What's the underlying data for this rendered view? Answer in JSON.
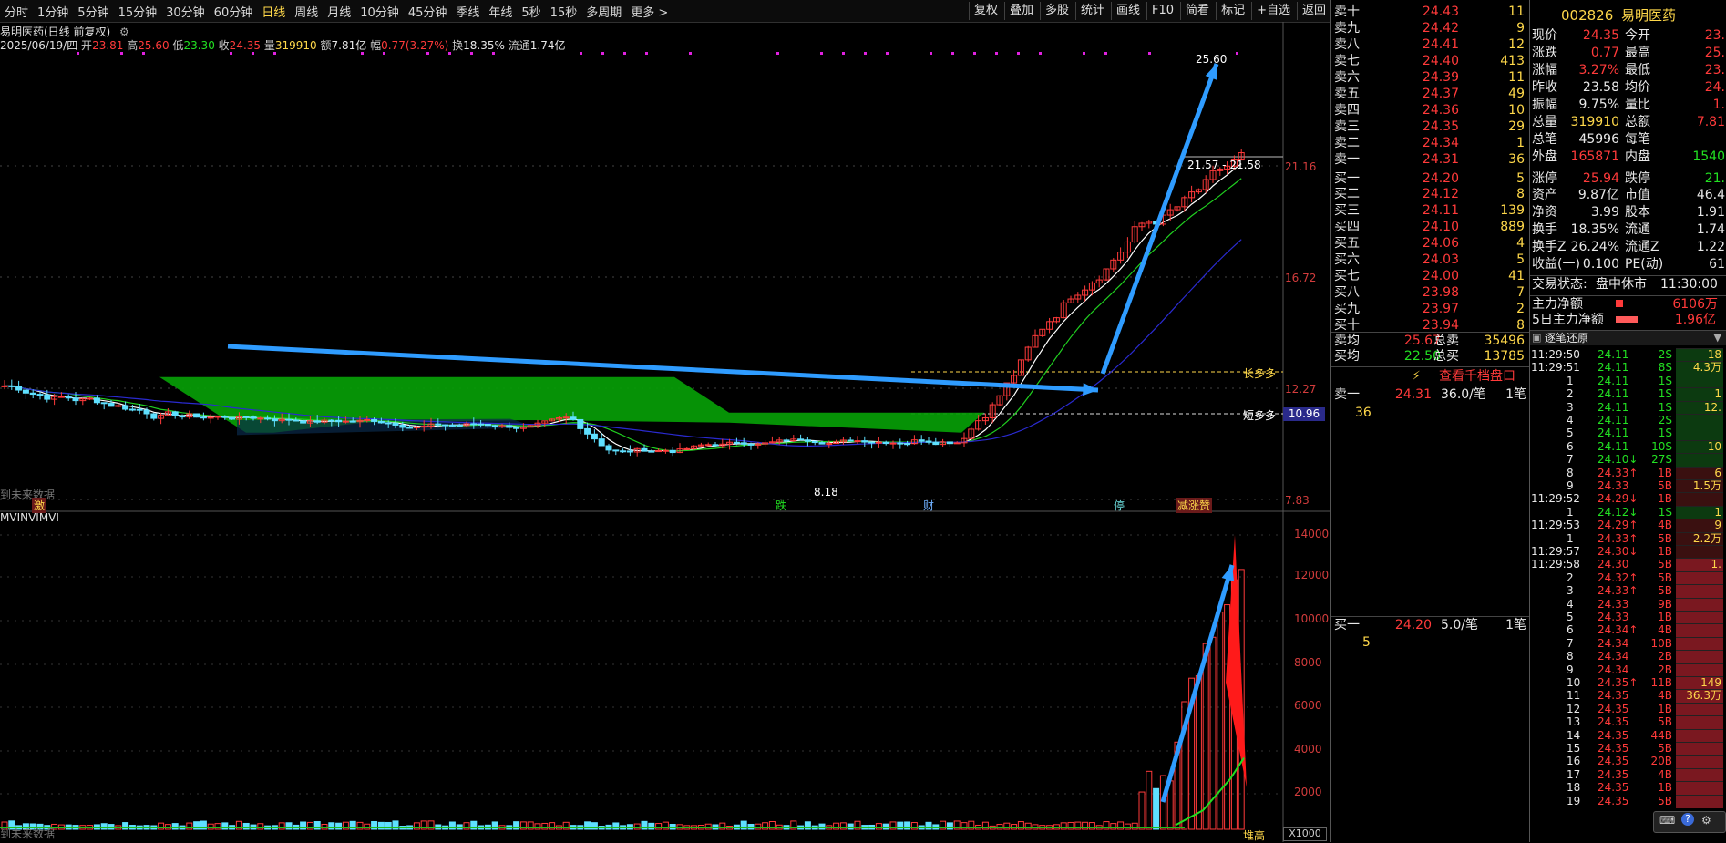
{
  "toolbar": {
    "periods": [
      "分时",
      "1分钟",
      "5分钟",
      "15分钟",
      "30分钟",
      "60分钟",
      "日线",
      "周线",
      "月线",
      "10分钟",
      "45分钟",
      "季线",
      "年线",
      "5秒",
      "15秒",
      "多周期",
      "更多 >"
    ],
    "active_period": "日线",
    "right_buttons": [
      "复权",
      "叠加",
      "多股",
      "统计",
      "画线",
      "F10",
      "简看",
      "标记",
      "+自选",
      "返回"
    ]
  },
  "chart": {
    "title": "易明医药(日线 前复权)",
    "date": "2025/06/19/四",
    "open_label": "开",
    "open": "23.81",
    "high_label": "高",
    "high": "25.60",
    "low_label": "低",
    "low": "23.30",
    "close_label": "收",
    "close": "24.35",
    "vol_label": "量",
    "vol": "319910",
    "amount_label": "额",
    "amount": "7.81亿",
    "change_label": "幅",
    "change": "0.77(3.27%)",
    "turnover_label": "换",
    "turnover": "18.35%",
    "float_label": "流通",
    "float_value": "1.74亿",
    "y_ticks": [
      "21.16",
      "16.72",
      "12.27",
      "7.83"
    ],
    "current_price_tag": "10.96",
    "peak_label": "25.60",
    "range_label": "21.57 - 21.58",
    "low_mark": "8.18",
    "long_line_label": "长多多",
    "short_line_label": "短多多",
    "future_note": "到未来数据",
    "markers": [
      "激",
      "跌",
      "财",
      "停",
      "减涨赞"
    ],
    "indicator_title": "MVINVIMVI",
    "vol_ticks": [
      "14000",
      "12000",
      "10000",
      "8000",
      "6000",
      "4000",
      "2000"
    ],
    "vol_unit": "X1000",
    "vol_bottom_note": "到未来数据",
    "vol_peak_label": "堆高"
  },
  "orderbook": {
    "asks": [
      {
        "label": "卖十",
        "price": "24.43",
        "vol": "11"
      },
      {
        "label": "卖九",
        "price": "24.42",
        "vol": "9"
      },
      {
        "label": "卖八",
        "price": "24.41",
        "vol": "12"
      },
      {
        "label": "卖七",
        "price": "24.40",
        "vol": "413"
      },
      {
        "label": "卖六",
        "price": "24.39",
        "vol": "11"
      },
      {
        "label": "卖五",
        "price": "24.37",
        "vol": "49"
      },
      {
        "label": "卖四",
        "price": "24.36",
        "vol": "10"
      },
      {
        "label": "卖三",
        "price": "24.35",
        "vol": "29"
      },
      {
        "label": "卖二",
        "price": "24.34",
        "vol": "1"
      },
      {
        "label": "卖一",
        "price": "24.31",
        "vol": "36"
      }
    ],
    "bids": [
      {
        "label": "买一",
        "price": "24.20",
        "vol": "5"
      },
      {
        "label": "买二",
        "price": "24.12",
        "vol": "8"
      },
      {
        "label": "买三",
        "price": "24.11",
        "vol": "139"
      },
      {
        "label": "买四",
        "price": "24.10",
        "vol": "889"
      },
      {
        "label": "买五",
        "price": "24.06",
        "vol": "4"
      },
      {
        "label": "买六",
        "price": "24.03",
        "vol": "5"
      },
      {
        "label": "买七",
        "price": "24.00",
        "vol": "41"
      },
      {
        "label": "买八",
        "price": "23.98",
        "vol": "7"
      },
      {
        "label": "买九",
        "price": "23.97",
        "vol": "2"
      },
      {
        "label": "买十",
        "price": "23.94",
        "vol": "8"
      }
    ],
    "avg_ask_label": "卖均",
    "avg_ask": "25.67",
    "total_ask_label": "总卖",
    "total_ask": "35496",
    "avg_bid_label": "买均",
    "avg_bid": "22.50",
    "total_bid_label": "总买",
    "total_bid": "13785",
    "depth_link": "查看千档盘口",
    "ask1_label": "卖一",
    "ask1_price": "24.31",
    "ask1_per": "36.0/笔",
    "ask1_count": "1笔",
    "ask1_vol": "36",
    "bid1_label": "买一",
    "bid1_price": "24.20",
    "bid1_per": "5.0/笔",
    "bid1_count": "1笔",
    "bid1_vol": "5"
  },
  "stats": {
    "code": "002826",
    "name": "易明医药",
    "rows": [
      {
        "l1": "现价",
        "v1": "24.35",
        "l2": "今开",
        "v2": "23."
      },
      {
        "l1": "涨跌",
        "v1": "0.77",
        "l2": "最高",
        "v2": "25."
      },
      {
        "l1": "涨幅",
        "v1": "3.27%",
        "l2": "最低",
        "v2": "23."
      },
      {
        "l1": "昨收",
        "v1": "23.58",
        "l2": "均价",
        "v2": "24."
      },
      {
        "l1": "振幅",
        "v1": "9.75%",
        "l2": "量比",
        "v2": "1."
      },
      {
        "l1": "总量",
        "v1": "319910",
        "l2": "总额",
        "v2": "7.81"
      },
      {
        "l1": "总笔",
        "v1": "45996",
        "l2": "每笔",
        "v2": ""
      },
      {
        "l1": "外盘",
        "v1": "165871",
        "l2": "内盘",
        "v2": "1540"
      }
    ],
    "rows2": [
      {
        "l1": "涨停",
        "v1": "25.94",
        "l2": "跌停",
        "v2": "21."
      },
      {
        "l1": "资产",
        "v1": "9.87亿",
        "l2": "市值",
        "v2": "46.4"
      },
      {
        "l1": "净资",
        "v1": "3.99",
        "l2": "股本",
        "v2": "1.91"
      },
      {
        "l1": "换手",
        "v1": "18.35%",
        "l2": "流通",
        "v2": "1.74"
      },
      {
        "l1": "换手Z",
        "v1": "26.24%",
        "l2": "流通Z",
        "v2": "1.22"
      },
      {
        "l1": "收益(一)",
        "v1": "0.100",
        "l2": "PE(动)",
        "v2": "61"
      }
    ],
    "trade_status_label": "交易状态:",
    "trade_status": "盘中休市",
    "trade_time": "11:30:00",
    "main_net_label": "主力净额",
    "main_net": "6106万",
    "main_net5_label": "5日主力净额",
    "main_net5": "1.96亿",
    "ticks_title": "逐笔还原",
    "ticks": [
      {
        "t": "11:29:50",
        "p": "24.11",
        "v": "2S",
        "c": "g"
      },
      {
        "t": "11:29:51",
        "p": "24.11",
        "v": "8S",
        "c": "g"
      },
      {
        "t": "1",
        "p": "24.11",
        "v": "1S",
        "c": "g"
      },
      {
        "t": "2",
        "p": "24.11",
        "v": "1S",
        "c": "g"
      },
      {
        "t": "3",
        "p": "24.11",
        "v": "1S",
        "c": "g"
      },
      {
        "t": "4",
        "p": "24.11",
        "v": "2S",
        "c": "g"
      },
      {
        "t": "5",
        "p": "24.11",
        "v": "1S",
        "c": "g"
      },
      {
        "t": "6",
        "p": "24.11",
        "v": "10S",
        "c": "g"
      },
      {
        "t": "7",
        "p": "24.10↓",
        "v": "27S",
        "c": "g"
      },
      {
        "t": "8",
        "p": "24.33↑",
        "v": "1B",
        "c": "r"
      },
      {
        "t": "9",
        "p": "24.33",
        "v": "5B",
        "c": "r"
      },
      {
        "t": "11:29:52",
        "p": "24.29↓",
        "v": "1B",
        "c": "r"
      },
      {
        "t": "1",
        "p": "24.12↓",
        "v": "1S",
        "c": "g"
      },
      {
        "t": "11:29:53",
        "p": "24.29↑",
        "v": "4B",
        "c": "r"
      },
      {
        "t": "1",
        "p": "24.33↑",
        "v": "5B",
        "c": "r"
      },
      {
        "t": "11:29:57",
        "p": "24.30↓",
        "v": "1B",
        "c": "r"
      },
      {
        "t": "11:29:58",
        "p": "24.30",
        "v": "5B",
        "c": "r"
      },
      {
        "t": "2",
        "p": "24.32↑",
        "v": "5B",
        "c": "r"
      },
      {
        "t": "3",
        "p": "24.33↑",
        "v": "5B",
        "c": "r"
      },
      {
        "t": "4",
        "p": "24.33",
        "v": "9B",
        "c": "r"
      },
      {
        "t": "5",
        "p": "24.33",
        "v": "1B",
        "c": "r"
      },
      {
        "t": "6",
        "p": "24.34↑",
        "v": "4B",
        "c": "r"
      },
      {
        "t": "7",
        "p": "24.34",
        "v": "10B",
        "c": "r"
      },
      {
        "t": "8",
        "p": "24.34",
        "v": "2B",
        "c": "r"
      },
      {
        "t": "9",
        "p": "24.34",
        "v": "2B",
        "c": "r"
      },
      {
        "t": "10",
        "p": "24.35↑",
        "v": "11B",
        "c": "r"
      },
      {
        "t": "11",
        "p": "24.35",
        "v": "4B",
        "c": "r"
      },
      {
        "t": "12",
        "p": "24.35",
        "v": "1B",
        "c": "r"
      },
      {
        "t": "13",
        "p": "24.35",
        "v": "5B",
        "c": "r"
      },
      {
        "t": "14",
        "p": "24.35",
        "v": "44B",
        "c": "r"
      },
      {
        "t": "15",
        "p": "24.35",
        "v": "5B",
        "c": "r"
      },
      {
        "t": "16",
        "p": "24.35",
        "v": "20B",
        "c": "r"
      },
      {
        "t": "17",
        "p": "24.35",
        "v": "4B",
        "c": "r"
      },
      {
        "t": "18",
        "p": "24.35",
        "v": "1B",
        "c": "r"
      },
      {
        "t": "19",
        "p": "24.35",
        "v": "5B",
        "c": "r"
      }
    ],
    "tick_bar_labels": [
      {
        "text": "18",
        "row": 0
      },
      {
        "text": "4.3万",
        "row": 1
      },
      {
        "text": "1",
        "row": 3
      },
      {
        "text": "12.",
        "row": 4
      },
      {
        "text": "10",
        "row": 7
      },
      {
        "text": "6",
        "row": 9
      },
      {
        "text": "1.5万",
        "row": 10
      },
      {
        "text": "1",
        "row": 12
      },
      {
        "text": "9",
        "row": 13
      },
      {
        "text": "2.2万",
        "row": 14
      },
      {
        "text": "1.",
        "row": 16
      },
      {
        "text": "149",
        "row": 25
      },
      {
        "text": "36.3万",
        "row": 26
      }
    ]
  }
}
